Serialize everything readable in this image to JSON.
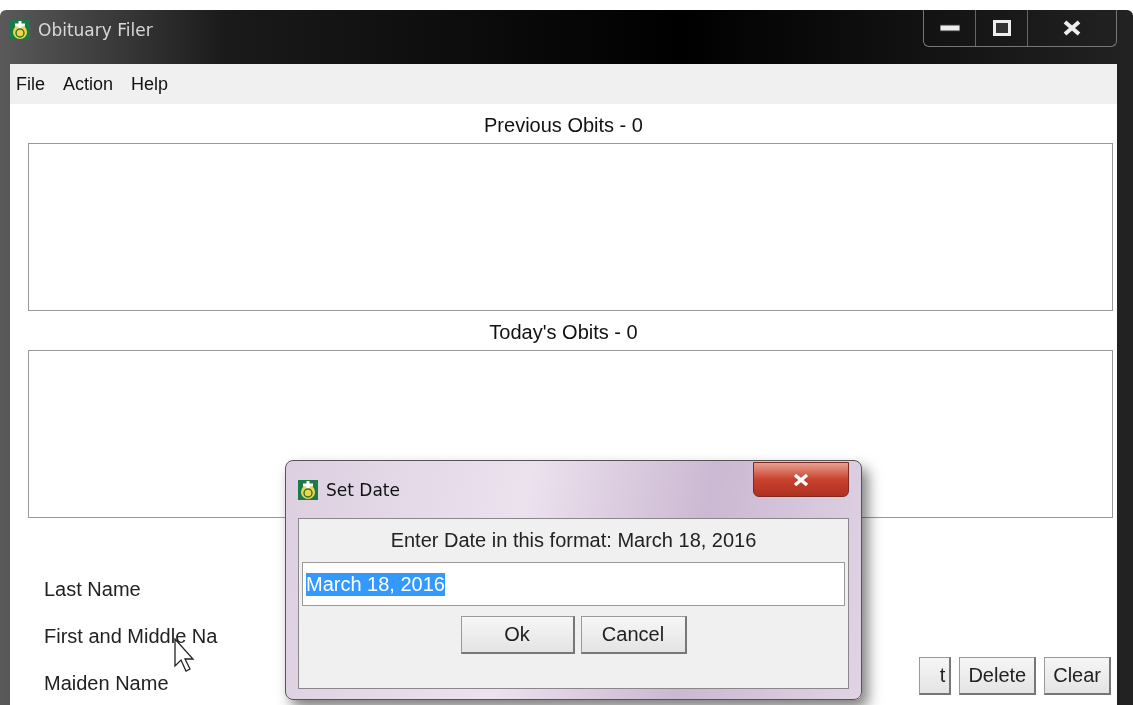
{
  "window": {
    "title": "Obituary Filer"
  },
  "menu": [
    "File",
    "Action",
    "Help"
  ],
  "previous": {
    "heading": "Previous Obits - 0"
  },
  "today": {
    "heading": "Today's Obits - 0"
  },
  "form": {
    "fields": [
      {
        "label": "Last Name"
      },
      {
        "label": "First and Middle Na"
      },
      {
        "label": "Maiden Name"
      }
    ],
    "buttons": [
      "t",
      "Delete",
      "Clear"
    ]
  },
  "dialog": {
    "title": "Set Date",
    "prompt": "Enter Date in this format: March 18, 2016",
    "value": "March 18, 2016",
    "value_selected": true,
    "buttons": [
      "Ok",
      "Cancel"
    ]
  }
}
